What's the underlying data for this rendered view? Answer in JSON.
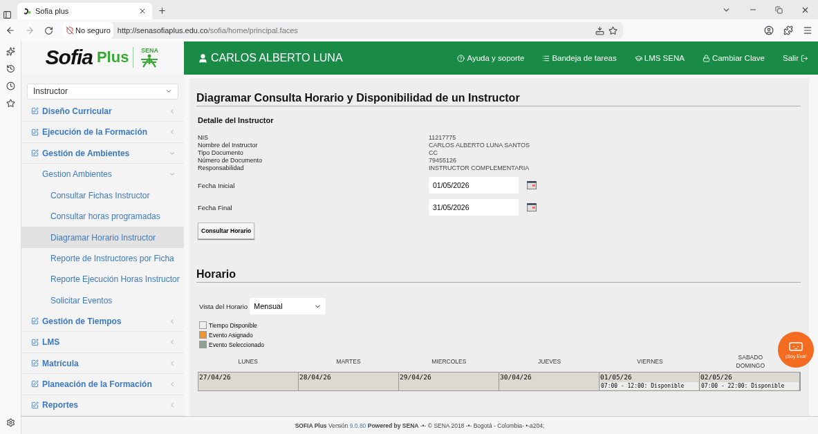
{
  "browser": {
    "tab_title": "Sofia plus",
    "security": "No seguro",
    "url_host": "http://senasofiaplus.edu.co",
    "url_path": "/sofia/home/principal.faces"
  },
  "logo": {
    "name": "Sofia",
    "suffix": "Plus",
    "org": "SENA"
  },
  "header": {
    "user": "CARLOS ALBERTO LUNA",
    "links": [
      "Ayuda y soporte",
      "Bandeja de tareas",
      "LMS SENA",
      "Cambiar Clave",
      "Salir"
    ]
  },
  "sidebar": {
    "role": "Instructor",
    "items": [
      {
        "label": "Diseño Curricular",
        "expanded": false
      },
      {
        "label": "Ejecución de la Formación",
        "expanded": false
      },
      {
        "label": "Gestión de Ambientes",
        "expanded": true,
        "children": [
          {
            "label": "Gestion Ambientes",
            "expanded": true,
            "children": [
              {
                "label": "Consultar Fichas Instructor",
                "selected": false
              },
              {
                "label": "Consultar horas programadas",
                "selected": false
              },
              {
                "label": "Diagramar Horario Instructor",
                "selected": true
              },
              {
                "label": "Reporte de Instructores por Ficha",
                "selected": false
              },
              {
                "label": "Reporte Ejecución Horas Instructor",
                "selected": false
              },
              {
                "label": "Solicitar Eventos",
                "selected": false
              }
            ]
          }
        ]
      },
      {
        "label": "Gestión de Tiempos",
        "expanded": false
      },
      {
        "label": "LMS",
        "expanded": false
      },
      {
        "label": "Matrícula",
        "expanded": false
      },
      {
        "label": "Planeación de la Formación",
        "expanded": false
      },
      {
        "label": "Reportes",
        "expanded": false
      }
    ]
  },
  "detail": {
    "title": "Diagramar Consulta Horario y Disponibilidad de un Instructor",
    "section": "Detalle del Instructor",
    "fields": [
      {
        "label": "NIS",
        "value": "11217775"
      },
      {
        "label": "Nombre del Instructor",
        "value": "CARLOS ALBERTO LUNA SANTOS"
      },
      {
        "label": "Tipo Documento",
        "value": "CC"
      },
      {
        "label": "Número de Documento",
        "value": "79455126"
      },
      {
        "label": "Responsabilidad",
        "value": "INSTRUCTOR COMPLEMENTARIA"
      }
    ],
    "dates": [
      {
        "label": "Fecha Inicial",
        "value": "01/05/2026"
      },
      {
        "label": "Fecha Final",
        "value": "31/05/2026"
      }
    ],
    "button": "Consultar Horario"
  },
  "schedule": {
    "title": "Horario",
    "view_label": "Vista del Horario",
    "view": "Mensual",
    "legend": [
      {
        "label": "Tiempo Disponible",
        "color": "#eeeeee"
      },
      {
        "label": "Evento Asignado",
        "color": "#f0952e"
      },
      {
        "label": "Evento Seleccionado",
        "color": "#8fa293"
      }
    ],
    "days": [
      "LUNES",
      "MARTES",
      "MIERCOLES",
      "JUEVES",
      "VIERNES",
      "SABADO DOMINGO"
    ],
    "cells": [
      {
        "date": "27/04/26"
      },
      {
        "date": "28/04/26"
      },
      {
        "date": "29/04/26"
      },
      {
        "date": "30/04/26"
      },
      {
        "date": "01/05/26",
        "entry": "07:00 - 12:00: Disponible"
      },
      {
        "date": "02/05/26",
        "entry": "07:00 - 22:00: Disponible"
      }
    ]
  },
  "assistant": {
    "label": "¡Soy Eva!"
  },
  "footer": {
    "lead": "**SOFIA Plus** Versión",
    "version": "9.0.80",
    "tail": "**Powered by SENA** -•- © SENA 2018 -•- Bogotá - Colombia- •-a204;"
  }
}
